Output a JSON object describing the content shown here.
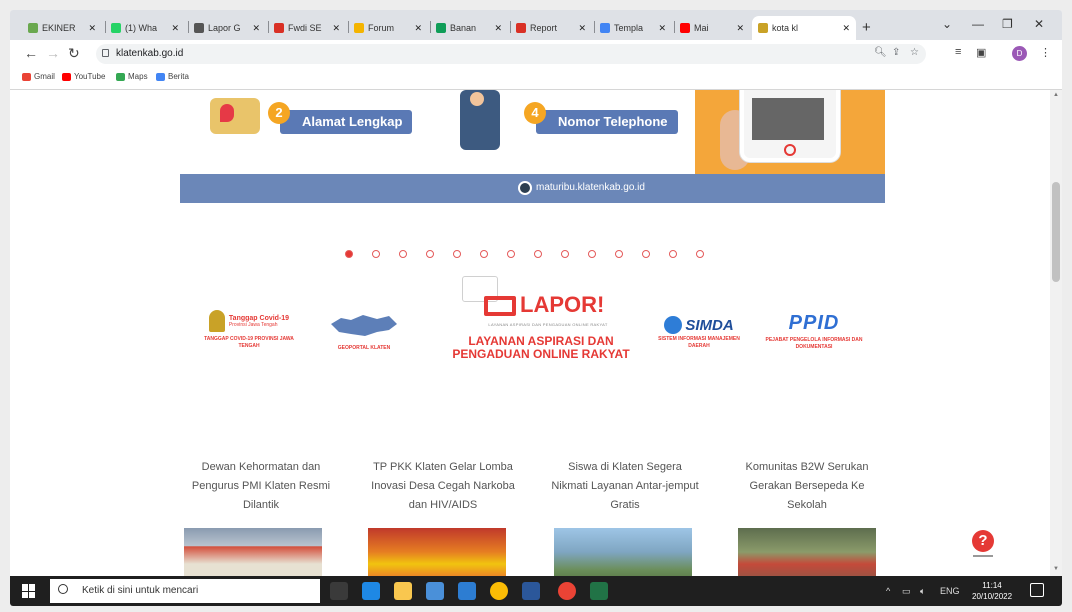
{
  "browser": {
    "tabs": [
      {
        "label": "EKINER",
        "color": "#6aa84f"
      },
      {
        "label": "(1) Wha",
        "color": "#25d366"
      },
      {
        "label": "Lapor G",
        "color": "#555555"
      },
      {
        "label": "Fwdi SE",
        "color": "#d93025"
      },
      {
        "label": "Forum",
        "color": "#f4b400"
      },
      {
        "label": "Banan",
        "color": "#0f9d58"
      },
      {
        "label": "Report",
        "color": "#d93025"
      },
      {
        "label": "Templa",
        "color": "#4285f4"
      },
      {
        "label": "Mai",
        "color": "#ff0000"
      },
      {
        "label": "kota kl",
        "color": "#c9a227"
      }
    ],
    "new_tab": "+",
    "address": "klatenkab.go.id",
    "bookmarks": [
      {
        "label": "Gmail",
        "color": "#ea4335"
      },
      {
        "label": "YouTube",
        "color": "#ff0000"
      },
      {
        "label": "Maps",
        "color": "#34a853"
      },
      {
        "label": "Berita",
        "color": "#4285f4"
      }
    ],
    "profile_initial": "D"
  },
  "banner": {
    "step2_num": "2",
    "step2_label": "Alamat Lengkap",
    "step4_num": "4",
    "step4_label": "Nomor Telephone",
    "site_url": "maturibu.klatenkab.go.id"
  },
  "carousel": {
    "dot_count": 14,
    "active_index": 0
  },
  "logos": {
    "covid_title": "Tanggap Covid-19",
    "covid_sub": "Provinsi Jawa Tengah",
    "covid_caption": "TANGGAP COVID-19 PROVINSI JAWA TENGAH",
    "geoportal_caption": "GEOPORTAL KLATEN",
    "lapor_word": "LAPOR!",
    "lapor_sub": "LAYANAN ASPIRASI DAN PENGADUAN ONLINE RAKYAT",
    "lapor_title": "LAYANAN ASPIRASI DAN PENGADUAN ONLINE RAKYAT",
    "simda_word": "SIMDA",
    "simda_caption": "SISTEM INFORMASI MANAJEMEN DAERAH",
    "ppid_word": "PPID",
    "ppid_caption": "PEJABAT PENGELOLA INFORMASI DAN DOKUMENTASI"
  },
  "news": [
    {
      "title": "Dewan Kehormatan dan Pengurus PMI Klaten Resmi Dilantik"
    },
    {
      "title": "TP PKK Klaten Gelar Lomba Inovasi Desa Cegah Narkoba dan HIV/AIDS"
    },
    {
      "title": "Siswa di Klaten Segera Nikmati Layanan Antar-jemput Gratis"
    },
    {
      "title": "Komunitas B2W Serukan Gerakan Bersepeda Ke Sekolah"
    }
  ],
  "help": "?",
  "taskbar": {
    "search_placeholder": "Ketik di sini untuk mencari",
    "apps": [
      {
        "name": "task-view",
        "color": "#3a3a3a"
      },
      {
        "name": "edge",
        "color": "#1e88e5"
      },
      {
        "name": "file-explorer",
        "color": "#f9c74f"
      },
      {
        "name": "store",
        "color": "#4a90d9"
      },
      {
        "name": "mail",
        "color": "#2d7dd2"
      },
      {
        "name": "chrome",
        "color": "#fbbc05"
      },
      {
        "name": "word",
        "color": "#2b579a"
      },
      {
        "name": "chrome-active",
        "color": "#ea4335"
      },
      {
        "name": "excel",
        "color": "#217346"
      }
    ],
    "lang": "ENG",
    "time": "11:14",
    "date": "20/10/2022"
  }
}
